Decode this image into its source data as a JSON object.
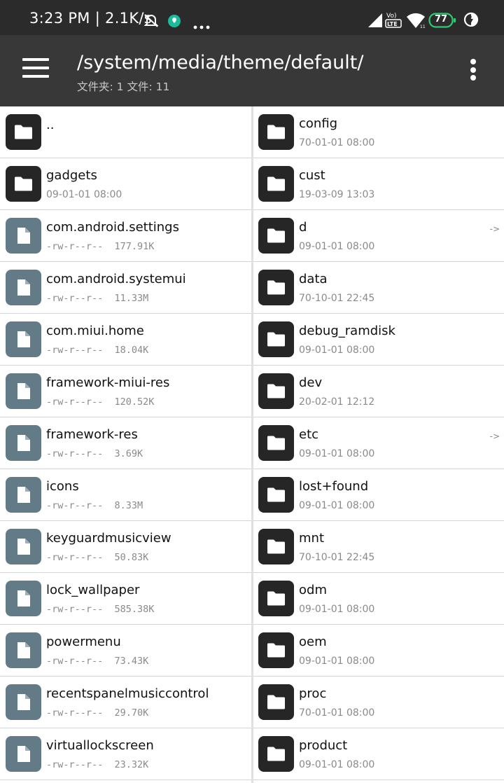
{
  "status_bar": {
    "time_speed": "3:23 PM | 2.1K/s",
    "battery": "77",
    "icons": [
      "alarm-off-icon",
      "app-notification-icon",
      "more-dots-icon",
      "signal-icon",
      "volte-icon",
      "wifi-icon",
      "battery-icon",
      "data-saver-icon"
    ],
    "volte_label": "Vo)\nLTE"
  },
  "app_bar": {
    "path": "/system/media/theme/default/",
    "counts": "文件夹: 1   文件: 11",
    "icons": [
      "hamburger-menu-icon",
      "overflow-menu-icon"
    ]
  },
  "left_pane": {
    "items": [
      {
        "name": "..",
        "meta": "",
        "type": "folder"
      },
      {
        "name": "gadgets",
        "meta": "09-01-01 08:00",
        "type": "folder"
      },
      {
        "name": "com.android.settings",
        "meta": "-rw-r--r--  177.91K",
        "type": "file"
      },
      {
        "name": "com.android.systemui",
        "meta": "-rw-r--r--  11.33M",
        "type": "file"
      },
      {
        "name": "com.miui.home",
        "meta": "-rw-r--r--  18.04K",
        "type": "file"
      },
      {
        "name": "framework-miui-res",
        "meta": "-rw-r--r--  120.52K",
        "type": "file"
      },
      {
        "name": "framework-res",
        "meta": "-rw-r--r--  3.69K",
        "type": "file"
      },
      {
        "name": "icons",
        "meta": "-rw-r--r--  8.33M",
        "type": "file"
      },
      {
        "name": "keyguardmusicview",
        "meta": "-rw-r--r--  50.83K",
        "type": "file"
      },
      {
        "name": "lock_wallpaper",
        "meta": "-rw-r--r--  585.38K",
        "type": "file"
      },
      {
        "name": "powermenu",
        "meta": "-rw-r--r--  73.43K",
        "type": "file"
      },
      {
        "name": "recentspanelmusiccontrol",
        "meta": "-rw-r--r--  29.70K",
        "type": "file"
      },
      {
        "name": "virtuallockscreen",
        "meta": "-rw-r--r--  23.32K",
        "type": "file"
      }
    ]
  },
  "right_pane": {
    "items": [
      {
        "name": "config",
        "meta": "70-01-01 08:00",
        "type": "folder",
        "link": ""
      },
      {
        "name": "cust",
        "meta": "19-03-09 13:03",
        "type": "folder",
        "link": ""
      },
      {
        "name": "d",
        "meta": "09-01-01 08:00",
        "type": "folder",
        "link": "->"
      },
      {
        "name": "data",
        "meta": "70-10-01 22:45",
        "type": "folder",
        "link": ""
      },
      {
        "name": "debug_ramdisk",
        "meta": "09-01-01 08:00",
        "type": "folder",
        "link": ""
      },
      {
        "name": "dev",
        "meta": "20-02-01 12:12",
        "type": "folder",
        "link": ""
      },
      {
        "name": "etc",
        "meta": "09-01-01 08:00",
        "type": "folder",
        "link": "->"
      },
      {
        "name": "lost+found",
        "meta": "09-01-01 08:00",
        "type": "folder",
        "link": ""
      },
      {
        "name": "mnt",
        "meta": "70-10-01 22:45",
        "type": "folder",
        "link": ""
      },
      {
        "name": "odm",
        "meta": "09-01-01 08:00",
        "type": "folder",
        "link": ""
      },
      {
        "name": "oem",
        "meta": "09-01-01 08:00",
        "type": "folder",
        "link": ""
      },
      {
        "name": "proc",
        "meta": "70-01-01 08:00",
        "type": "folder",
        "link": ""
      },
      {
        "name": "product",
        "meta": "09-01-01 08:00",
        "type": "folder",
        "link": ""
      }
    ]
  },
  "colors": {
    "status_bar": "#2b2b2b",
    "app_bar": "#383838",
    "folder_icon": "#262626",
    "file_icon": "#637b87",
    "battery_outline": "#2ecc71"
  }
}
